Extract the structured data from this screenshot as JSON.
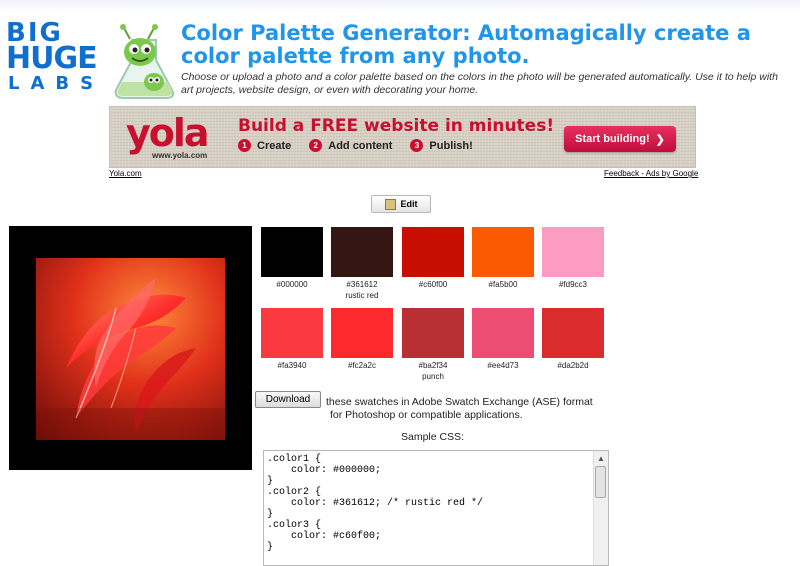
{
  "logo": {
    "line1": "BIG",
    "line2": "HUGE",
    "line3": "LABS"
  },
  "header": {
    "title": "Color Palette Generator: Automagically create a color palette from any photo.",
    "subtitle": "Choose or upload a photo and a color palette based on the colors in the photo will be generated automatically. Use it to help with art projects, website design, or even with decorating your home."
  },
  "ad": {
    "brand": "yola",
    "brand_url": "www.yola.com",
    "headline": "Build a FREE website in minutes!",
    "steps": [
      {
        "num": "1",
        "label": "Create"
      },
      {
        "num": "2",
        "label": "Add content"
      },
      {
        "num": "3",
        "label": "Publish!"
      }
    ],
    "cta": "Start building!",
    "link_left": "Yola.com",
    "link_right": "Feedback - Ads by Google"
  },
  "edit_label": "Edit",
  "swatches": [
    {
      "hex": "#000000",
      "label": "#000000",
      "name": ""
    },
    {
      "hex": "#361612",
      "label": "#361612",
      "name": "rustic red"
    },
    {
      "hex": "#c60f00",
      "label": "#c60f00",
      "name": ""
    },
    {
      "hex": "#fa5b00",
      "label": "#fa5b00",
      "name": ""
    },
    {
      "hex": "#fd9cc3",
      "label": "#fd9cc3",
      "name": ""
    },
    {
      "hex": "#fa3940",
      "label": "#fa3940",
      "name": ""
    },
    {
      "hex": "#fc2a2c",
      "label": "#fc2a2c",
      "name": ""
    },
    {
      "hex": "#ba2f34",
      "label": "#ba2f34",
      "name": "punch"
    },
    {
      "hex": "#ee4d73",
      "label": "#ee4d73",
      "name": ""
    },
    {
      "hex": "#da2b2d",
      "label": "#da2b2d",
      "name": ""
    }
  ],
  "download": {
    "button": "Download",
    "text_line1": "these swatches in Adobe Swatch Exchange (ASE) format",
    "text_line2": "for Photoshop or compatible applications."
  },
  "css": {
    "heading": "Sample CSS:",
    "code": ".color1 {\n    color: #000000;\n}\n.color2 {\n    color: #361612; /* rustic red */\n}\n.color3 {\n    color: #c60f00;\n}"
  },
  "icons": {
    "edit": "edit-icon",
    "scroll_up": "scroll-up-icon",
    "cta_arrow": "chevron-right-icon"
  }
}
